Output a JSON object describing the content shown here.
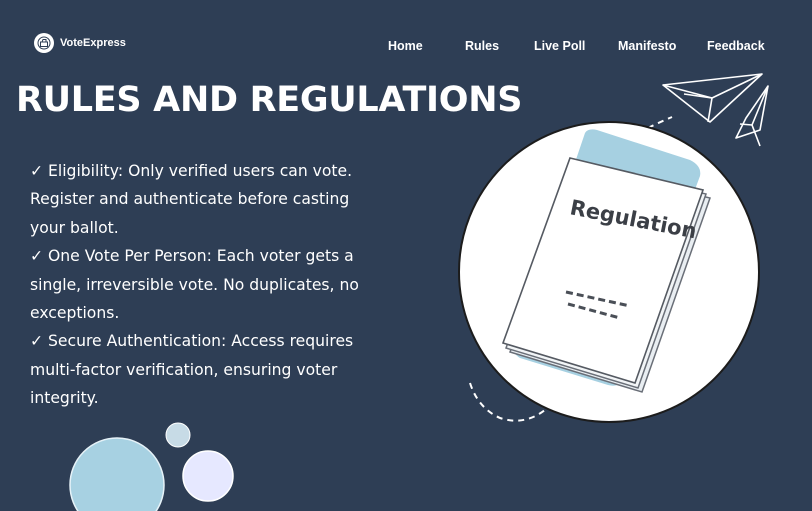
{
  "brand": {
    "name": "VoteExpress",
    "logo_icon": "vote-logo-icon"
  },
  "nav": {
    "items": [
      {
        "label": "Home"
      },
      {
        "label": "Rules"
      },
      {
        "label": "Live Poll"
      },
      {
        "label": "Manifesto"
      },
      {
        "label": "Feedback"
      }
    ]
  },
  "page": {
    "title": "RULES AND REGULATIONS"
  },
  "rules": [
    {
      "text": "✓ Eligibility: Only verified users can vote. Register and authenticate before casting your ballot."
    },
    {
      "text": "✓ One Vote Per Person: Each voter gets a single, irreversible vote. No duplicates, no exceptions."
    },
    {
      "text": "✓ Secure Authentication: Access requires multi-factor verification, ensuring voter integrity."
    }
  ],
  "illustration": {
    "document_label": "Regulation"
  },
  "colors": {
    "background": "#2e3e55",
    "text": "#ffffff",
    "circle_light_blue": "#a7d1e2",
    "circle_lavender": "#e6e8ff",
    "circle_grey_blue": "#c7dbe6",
    "folder_blue": "#a6d0e1"
  }
}
